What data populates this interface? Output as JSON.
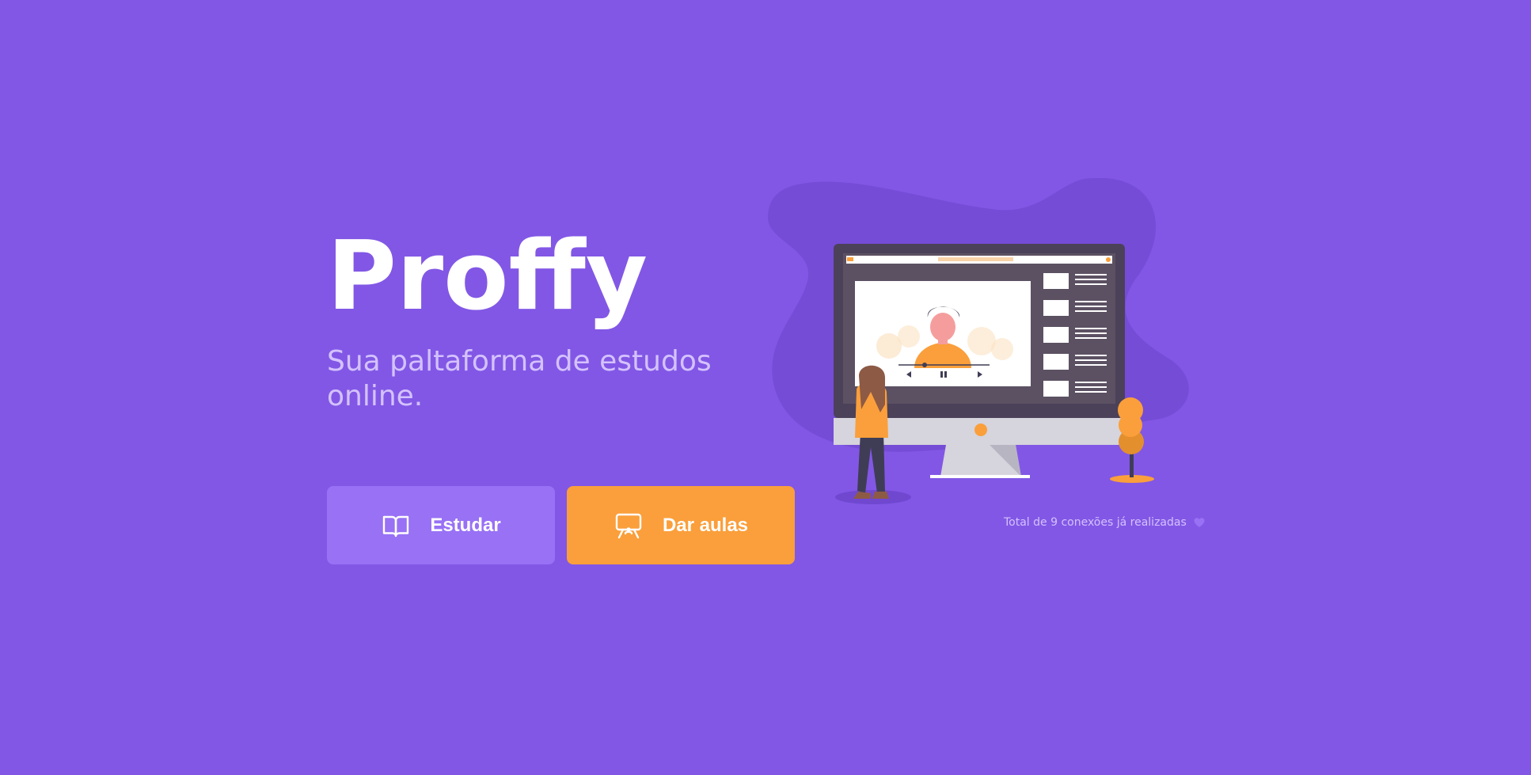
{
  "brand": {
    "name": "Proffy",
    "tagline": "Sua paltaforma de estudos online."
  },
  "actions": {
    "study_label": "Estudar",
    "give_classes_label": "Dar aulas",
    "study_icon": "book-open-icon",
    "give_classes_icon": "presentation-board-icon"
  },
  "stats": {
    "connections_text": "Total de 9 conexões já realizadas",
    "heart_icon": "purple-heart-icon"
  },
  "colors": {
    "background": "#8257e5",
    "primary_light": "#9871f5",
    "secondary": "#fa9f3b",
    "text_light": "#d4c2ff"
  }
}
